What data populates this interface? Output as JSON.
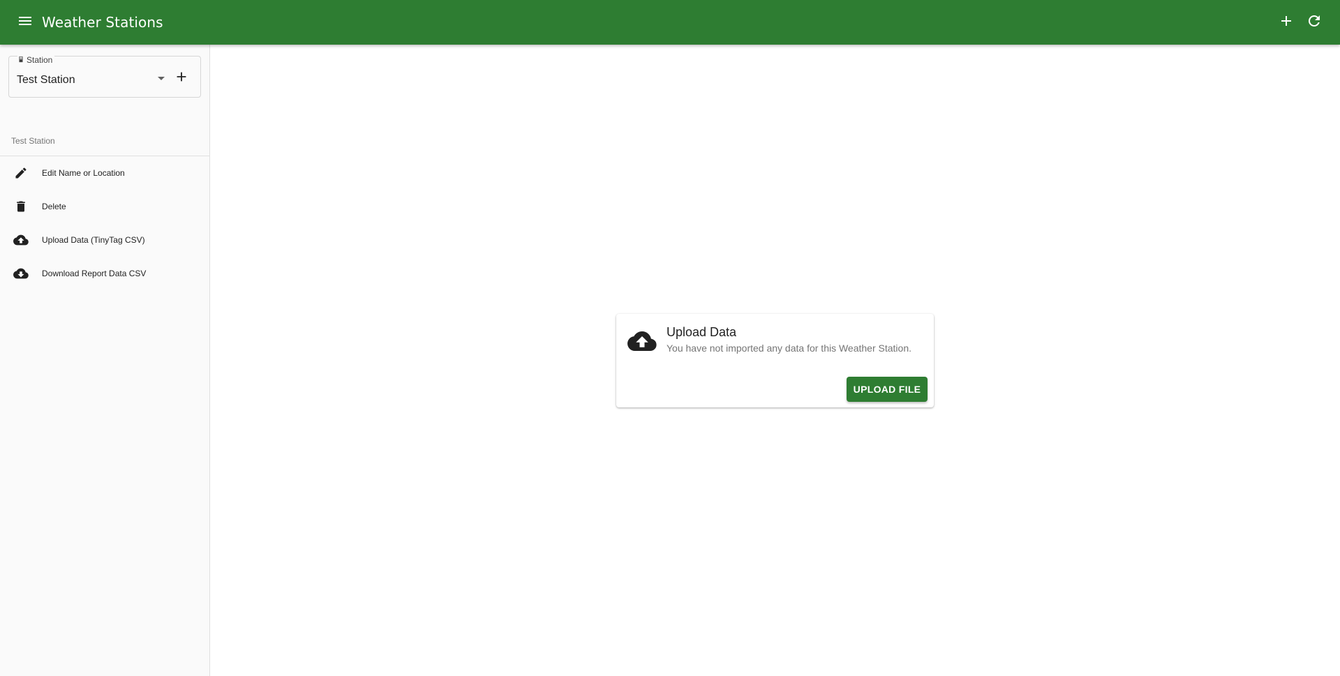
{
  "appbar": {
    "title": "Weather Stations",
    "icons": {
      "menu": "menu-icon",
      "add": "plus-icon",
      "refresh": "refresh-icon"
    },
    "color": "#2e7d32"
  },
  "drawer": {
    "station_field": {
      "label": "Station",
      "value": "Test Station",
      "icons": {
        "label": "station-icon",
        "caret": "caret-down-icon",
        "add": "plus-icon"
      }
    },
    "subheader": "Test Station",
    "items": [
      {
        "label": "Edit Name or Location",
        "icon": "pencil-icon"
      },
      {
        "label": "Delete",
        "icon": "trash-icon"
      },
      {
        "label": "Upload Data (TinyTag CSV)",
        "icon": "cloud-upload-icon"
      },
      {
        "label": "Download Report Data CSV",
        "icon": "cloud-download-icon"
      }
    ]
  },
  "main": {
    "card": {
      "icon": "cloud-upload-icon",
      "title": "Upload Data",
      "subtitle": "You have not imported any data for this Weather Station.",
      "button_label": "UPLOAD FILE"
    }
  }
}
